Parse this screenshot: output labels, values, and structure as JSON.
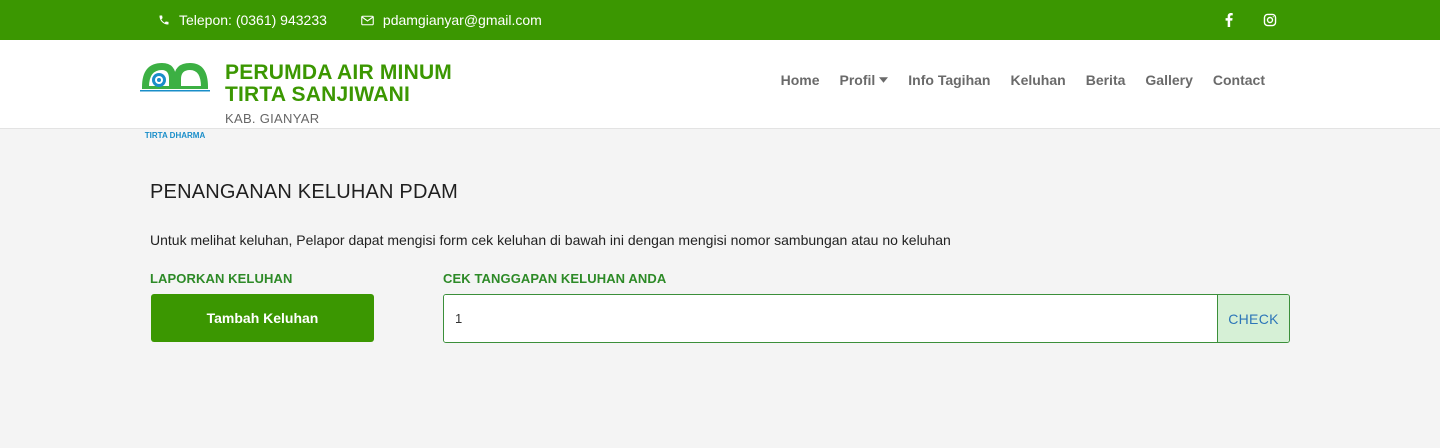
{
  "topbar": {
    "phone_icon": "phone-icon",
    "phone_text": "Telepon: (0361) 943233",
    "email_icon": "envelope-icon",
    "email_text": "pdamgianyar@gmail.com",
    "social": [
      "facebook-icon",
      "instagram-icon"
    ],
    "bg_color": "#3b9701"
  },
  "header": {
    "logo_caption": "TIRTA DHARMA",
    "brand_line1": "PERUMDA AIR MINUM",
    "brand_line2": "TIRTA SANJIWANI",
    "brand_sub": "KAB. GIANYAR",
    "brand_color": "#3b9701",
    "nav": {
      "home": "Home",
      "profil": "Profil",
      "info_tagihan": "Info Tagihan",
      "keluhan": "Keluhan",
      "berita": "Berita",
      "gallery": "Gallery",
      "contact": "Contact"
    }
  },
  "main": {
    "title": "PENANGANAN KELUHAN PDAM",
    "intro": "Untuk melihat keluhan, Pelapor dapat mengisi form cek keluhan di bawah ini dengan mengisi nomor sambungan atau no keluhan",
    "report_label": "LAPORKAN KELUHAN",
    "add_button": "Tambah Keluhan",
    "check_label": "CEK TANGGAPAN KELUHAN ANDA",
    "check_value": "1",
    "check_button": "CHECK"
  }
}
